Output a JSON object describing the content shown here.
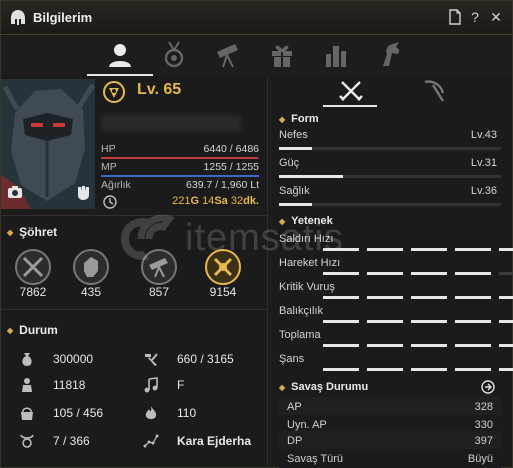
{
  "window": {
    "title": "Bilgilerim",
    "controls": [
      "doc-icon",
      "help-icon",
      "close-icon"
    ],
    "help_label": "?",
    "close_label": "✕"
  },
  "tabs": [
    "profile-icon",
    "medal-icon",
    "telescope-icon",
    "gift-icon",
    "chart-icon",
    "horse-icon"
  ],
  "character": {
    "level": "Lv. 65",
    "stats": [
      {
        "label": "HP",
        "value": "6440 / 6486"
      },
      {
        "label": "MP",
        "value": "1255 / 1255"
      },
      {
        "label": "Ağırlık",
        "value": "639.7 / 1,960 Lt"
      }
    ],
    "hp_fraction": 0.993,
    "mp_fraction": 1.0,
    "time": {
      "d": "221",
      "d_unit": "G",
      "h": "14",
      "h_unit": "Sa",
      "m": "32",
      "m_unit": "dk."
    }
  },
  "fame": {
    "heading": "Şöhret",
    "medals": [
      {
        "icon": "crossed-swords-medal",
        "value": "7862"
      },
      {
        "icon": "fist-medal",
        "value": "435"
      },
      {
        "icon": "telescope-medal",
        "value": "857"
      },
      {
        "icon": "sun-swords-medal",
        "value": "9154"
      }
    ]
  },
  "status": {
    "heading": "Durum",
    "items": [
      {
        "icon": "coin-bag-icon",
        "value": "300000"
      },
      {
        "icon": "hammer-icon",
        "value": "660 / 3165"
      },
      {
        "icon": "person-icon",
        "value": "11818"
      },
      {
        "icon": "music-note-icon",
        "value": "F"
      },
      {
        "icon": "gift-bag-icon",
        "value": "105 / 456"
      },
      {
        "icon": "flame-icon",
        "value": "110"
      },
      {
        "icon": "taurus-icon",
        "value": "7 / 366"
      },
      {
        "icon": "constellation-icon",
        "value": "Kara Ejderha"
      }
    ]
  },
  "form": {
    "heading": "Form",
    "rows": [
      {
        "label": "Nefes",
        "value": "Lv.43",
        "fraction": 0.15
      },
      {
        "label": "Güç",
        "value": "Lv.31",
        "fraction": 0.29
      },
      {
        "label": "Sağlık",
        "value": "Lv.36",
        "fraction": 0.15
      }
    ]
  },
  "skills": {
    "heading": "Yetenek",
    "rows": [
      {
        "label": "Saldırı Hızı",
        "filled": 5
      },
      {
        "label": "Hareket Hızı",
        "filled": 4
      },
      {
        "label": "Kritik Vuruş",
        "filled": 5
      },
      {
        "label": "Balıkçılık",
        "filled": 5
      },
      {
        "label": "Toplama",
        "filled": 5
      },
      {
        "label": "Şans",
        "filled": 5
      }
    ]
  },
  "combat": {
    "heading": "Savaş Durumu",
    "rows": [
      {
        "label": "AP",
        "value": "328"
      },
      {
        "label": "Uyn. AP",
        "value": "330"
      },
      {
        "label": "DP",
        "value": "397"
      },
      {
        "label": "Savaş Türü",
        "value": "Büyü"
      }
    ]
  },
  "watermark": "itemsatis",
  "colors": {
    "accent": "#e9b84a",
    "bar": "#e6e6e6",
    "hp": "#c03b3b",
    "mp": "#3a6bc4"
  }
}
